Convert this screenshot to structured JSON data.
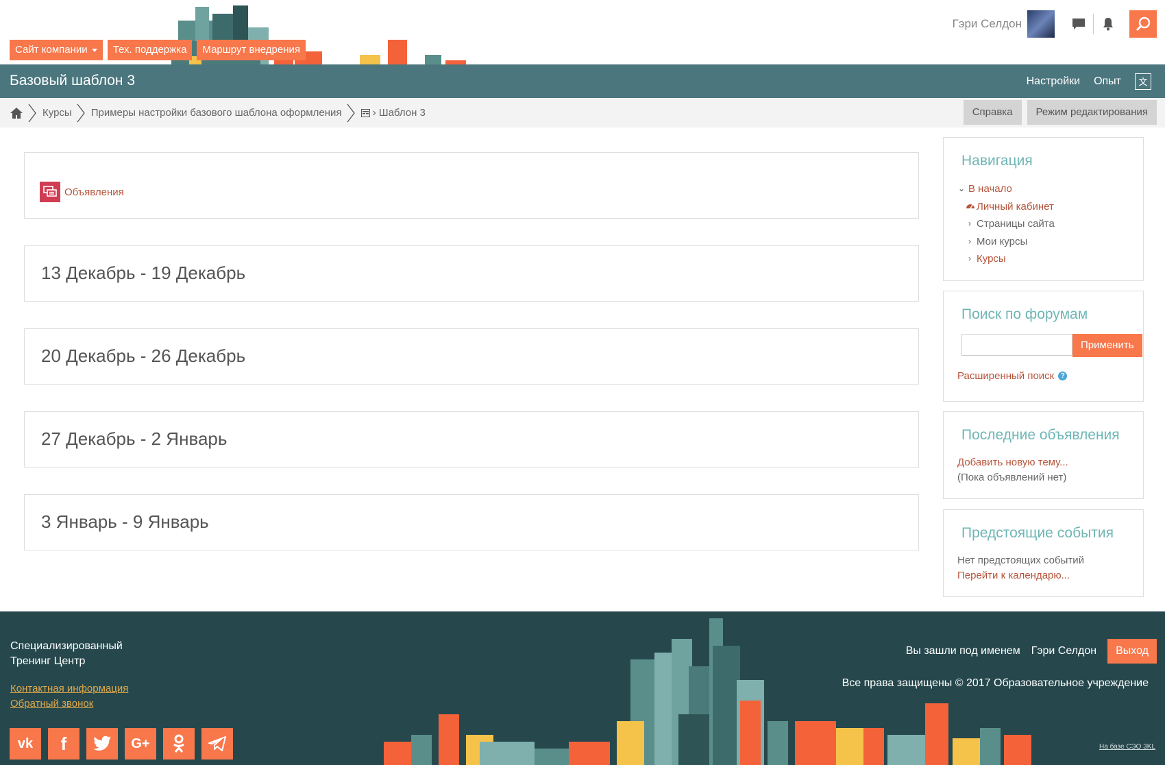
{
  "header": {
    "nav": [
      {
        "label": "Сайт компании",
        "has_caret": true
      },
      {
        "label": "Тех. поддержка"
      },
      {
        "label": "Маршрут внедрения"
      }
    ],
    "user_name": "Гэри Селдон",
    "icons": [
      "chat-icon",
      "bell-icon",
      "search-icon"
    ]
  },
  "titlebar": {
    "title": "Базовый шаблон 3",
    "links": [
      "Настройки",
      "Опыт"
    ],
    "translate_icon": "translate-icon"
  },
  "breadcrumb": {
    "items": [
      "Курсы",
      "Примеры настройки базового шаблона оформления",
      "Шаблон 3"
    ],
    "buttons": [
      "Справка",
      "Режим редактирования"
    ]
  },
  "main": {
    "announcement": "Объявления",
    "weeks": [
      "13 Декабрь - 19 Декабрь",
      "20 Декабрь - 26 Декабрь",
      "27 Декабрь - 2 Январь",
      "3 Январь - 9 Январь"
    ]
  },
  "sidebar": {
    "navigation": {
      "title": "Навигация",
      "home": "В начало",
      "dashboard": "Личный кабинет",
      "site_pages": "Страницы сайта",
      "my_courses": "Мои курсы",
      "courses": "Курсы"
    },
    "forum_search": {
      "title": "Поиск по форумам",
      "input_value": "",
      "button": "Применить",
      "advanced": "Расширенный поиск"
    },
    "news": {
      "title": "Последние объявления",
      "add": "Добавить новую тему...",
      "empty": "(Пока объявлений нет)"
    },
    "events": {
      "title": "Предстоящие события",
      "empty": "Нет предстоящих событий",
      "calendar": "Перейти к календарю..."
    }
  },
  "footer": {
    "brand_line1": "Специализированный",
    "brand_line2": "Тренинг Центр",
    "links": [
      "Контактная информация",
      "Обратный звонок"
    ],
    "social": [
      "vk-icon",
      "facebook-icon",
      "twitter-icon",
      "google-plus-icon",
      "odnoklassniki-icon",
      "telegram-icon"
    ],
    "logged_in_as": "Вы зашли под именем",
    "user_name": "Гэри Селдон",
    "logout": "Выход",
    "copyright": "Все права защищены © 2017 Образовательное учреждение",
    "powered": "На базе СЭО 3KL"
  },
  "colors": {
    "accent": "#f8774b",
    "header_bar": "#4b767e",
    "footer_bg": "#26484d",
    "block_title": "#6eb6b4",
    "link": "#b6533a"
  }
}
